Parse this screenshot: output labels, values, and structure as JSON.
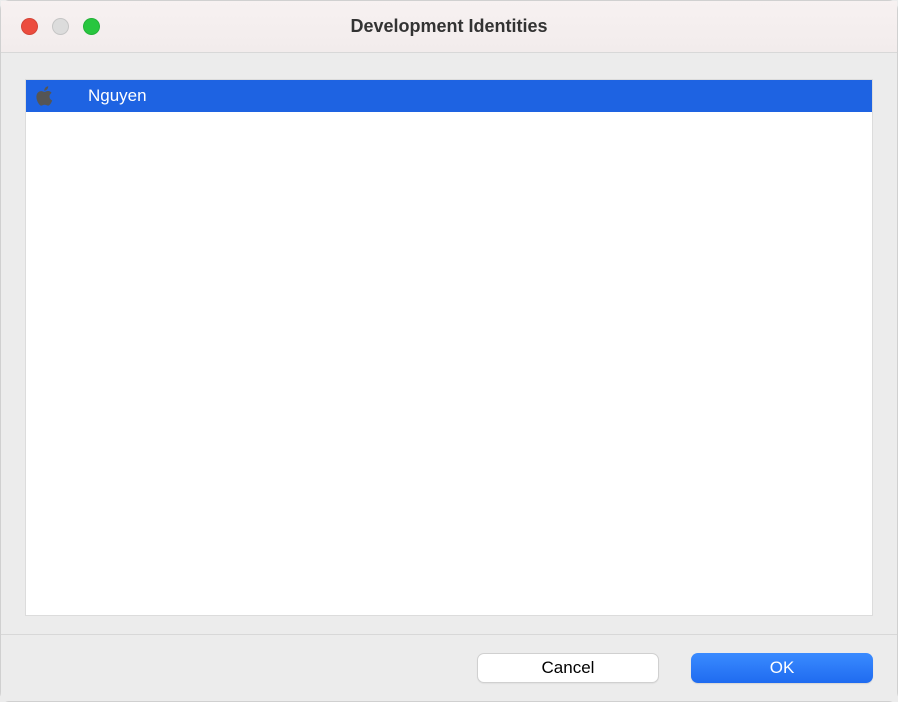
{
  "window": {
    "title": "Development Identities"
  },
  "list": {
    "items": [
      {
        "label": "Nguyen",
        "selected": true
      }
    ]
  },
  "footer": {
    "cancel_label": "Cancel",
    "ok_label": "OK"
  }
}
